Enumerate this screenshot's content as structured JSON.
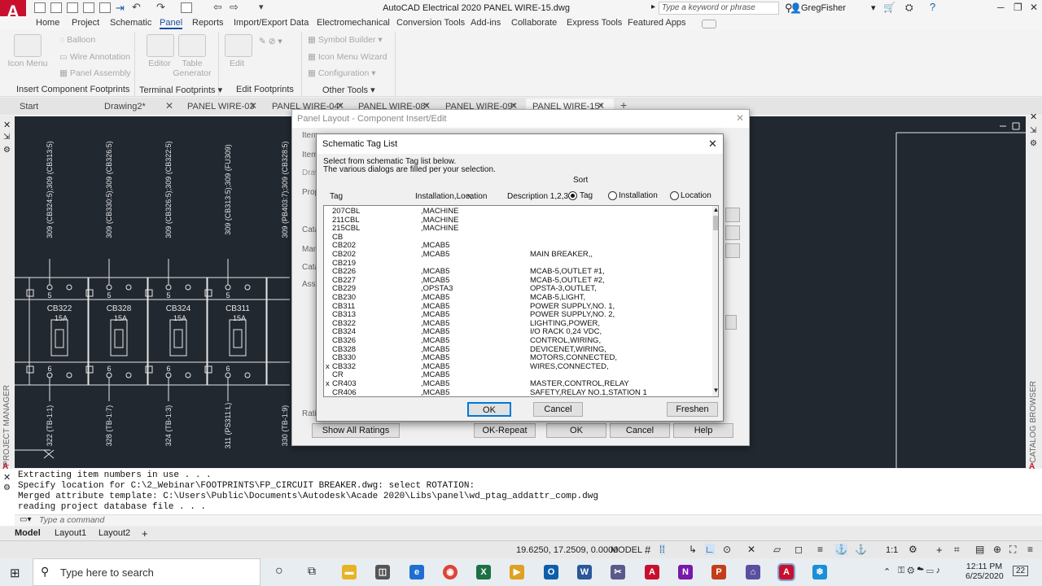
{
  "app": {
    "logo": "A",
    "title": "AutoCAD Electrical 2020  PANEL WIRE-15.dwg",
    "search_placeholder": "Type a keyword or phrase",
    "user": "GregFisher"
  },
  "ribbon": {
    "tabs": [
      "Home",
      "Project",
      "Schematic",
      "Panel",
      "Reports",
      "Import/Export Data",
      "Electromechanical",
      "Conversion Tools",
      "Add-ins",
      "Collaborate",
      "Express Tools",
      "Featured Apps"
    ],
    "active_tab": "Panel",
    "buttons": {
      "icon_menu": "Icon Menu",
      "balloon": "Balloon",
      "wire_annotation": "Wire Annotation",
      "panel_assembly": "Panel Assembly",
      "editor": "Editor",
      "table_generator": "Table Generator",
      "edit": "Edit",
      "symbol_builder": "Symbol Builder",
      "icon_menu_wizard": "Icon Menu  Wizard",
      "configuration": "Configuration"
    },
    "panels": [
      "Insert Component Footprints",
      "Terminal Footprints",
      "Edit Footprints",
      "Other Tools"
    ]
  },
  "file_tabs": [
    "Start",
    "Drawing2*",
    "PANEL WIRE-03",
    "PANEL WIRE-04*",
    "PANEL WIRE-08*",
    "PANEL WIRE-09*",
    "PANEL WIRE-15*"
  ],
  "active_file_tab": "PANEL WIRE-15*",
  "side_labels": {
    "left": "PROJECT MANAGER",
    "right": "CATALOG BROWSER"
  },
  "drawing": {
    "breakers": [
      {
        "name": "CB322",
        "rating": "15A",
        "ref": "322 (TB-1:1)",
        "top": "309 (CB324:5);309 (CB313:5)"
      },
      {
        "name": "CB328",
        "rating": "15A",
        "ref": "328 (TB-1:7)",
        "top": "309 (CB330:5);309 (CB326:5)"
      },
      {
        "name": "CB324",
        "rating": "15A",
        "ref": "324 (TB-1:3)",
        "top": "309 (CB326:5);309 (CB322:5)"
      },
      {
        "name": "CB311",
        "rating": "15A",
        "ref": "311 (PS311:L)",
        "top": "309 (CB313:5);309 (FU309)"
      }
    ],
    "extra_ref": "330 (TB-1:9)",
    "extra_top": "309 (PB403:7);309 (CB328:5)",
    "top_num": "5",
    "bot_num": "6"
  },
  "parent_dialog": {
    "title": "Panel Layout - Component Insert/Edit",
    "side_labels": [
      "Item",
      "Item",
      "Draw",
      "Prop",
      "Catal",
      "Manu",
      "Catal",
      "Ass"
    ],
    "rating_label": "Rati",
    "buttons": {
      "show_all": "Show All Ratings",
      "ok_repeat": "OK-Repeat",
      "ok": "OK",
      "cancel": "Cancel",
      "help": "Help"
    }
  },
  "tag_dialog": {
    "title": "Schematic Tag List",
    "instructions": [
      "Select from schematic Tag list below.",
      "The various dialogs are filled per your selection."
    ],
    "columns": {
      "tag": "Tag",
      "installation": "Installation,Location",
      "description": "Description 1,2,3"
    },
    "sort": {
      "label": "Sort",
      "options": [
        "Tag",
        "Installation",
        "Location"
      ],
      "selected": "Tag"
    },
    "rows": [
      {
        "mark": "",
        "tag": "207CBL",
        "inst": ",MACHINE",
        "desc": ""
      },
      {
        "mark": "",
        "tag": "211CBL",
        "inst": ",MACHINE",
        "desc": ""
      },
      {
        "mark": "",
        "tag": "215CBL",
        "inst": ",MACHINE",
        "desc": ""
      },
      {
        "mark": "",
        "tag": "CB",
        "inst": "",
        "desc": ""
      },
      {
        "mark": "",
        "tag": "CB202",
        "inst": ",MCAB5",
        "desc": ""
      },
      {
        "mark": "",
        "tag": "CB202",
        "inst": ",MCAB5",
        "desc": "MAIN BREAKER,,"
      },
      {
        "mark": "",
        "tag": "CB219",
        "inst": "",
        "desc": ""
      },
      {
        "mark": "",
        "tag": "CB226",
        "inst": ",MCAB5",
        "desc": "MCAB-5,OUTLET #1,"
      },
      {
        "mark": "",
        "tag": "CB227",
        "inst": ",MCAB5",
        "desc": "MCAB-5,OUTLET #2,"
      },
      {
        "mark": "",
        "tag": "CB229",
        "inst": ",OPSTA3",
        "desc": "OPSTA-3,OUTLET,"
      },
      {
        "mark": "",
        "tag": "CB230",
        "inst": ",MCAB5",
        "desc": "MCAB-5,LIGHT,"
      },
      {
        "mark": "",
        "tag": "CB311",
        "inst": ",MCAB5",
        "desc": "POWER SUPPLY,NO. 1,"
      },
      {
        "mark": "",
        "tag": "CB313",
        "inst": ",MCAB5",
        "desc": "POWER SUPPLY,NO. 2,"
      },
      {
        "mark": "",
        "tag": "CB322",
        "inst": ",MCAB5",
        "desc": "LIGHTING,POWER,"
      },
      {
        "mark": "",
        "tag": "CB324",
        "inst": ",MCAB5",
        "desc": "I/O RACK 0,24 VDC,"
      },
      {
        "mark": "",
        "tag": "CB326",
        "inst": ",MCAB5",
        "desc": "CONTROL,WIRING,"
      },
      {
        "mark": "",
        "tag": "CB328",
        "inst": ",MCAB5",
        "desc": "DEVICENET,WIRING,"
      },
      {
        "mark": "",
        "tag": "CB330",
        "inst": ",MCAB5",
        "desc": "MOTORS,CONNECTED,"
      },
      {
        "mark": "x",
        "tag": "CB332",
        "inst": ",MCAB5",
        "desc": "WIRES,CONNECTED,"
      },
      {
        "mark": "",
        "tag": "CR",
        "inst": ",MCAB5",
        "desc": ""
      },
      {
        "mark": "x",
        "tag": "CR403",
        "inst": ",MCAB5",
        "desc": "MASTER,CONTROL,RELAY"
      },
      {
        "mark": "",
        "tag": "CR406",
        "inst": ",MCAB5",
        "desc": "SAFETY,RELAY NO.1,STATION 1"
      }
    ],
    "buttons": {
      "ok": "OK",
      "cancel": "Cancel",
      "freshen": "Freshen"
    }
  },
  "command_line": {
    "history": [
      "Extracting item numbers in use . . .",
      "Specify location for C:\\2_Webinar\\FOOTPRINTS\\FP_CIRCUIT BREAKER.dwg: select ROTATION:",
      " Merged attribute template: C:\\Users\\Public\\Documents\\Autodesk\\Acade 2020\\Libs\\panel\\wd_ptag_addattr_comp.dwg",
      " reading project database file . . ."
    ],
    "placeholder": "Type a command"
  },
  "layout_tabs": [
    "Model",
    "Layout1",
    "Layout2",
    "+"
  ],
  "status_bar": {
    "coords": "19.6250, 17.2509, 0.0000",
    "mode": "MODEL",
    "scale": "1:1"
  },
  "taskbar": {
    "search_placeholder": "Type here to search",
    "time": "12:11 PM",
    "date": "6/25/2020",
    "notifications": "22"
  }
}
